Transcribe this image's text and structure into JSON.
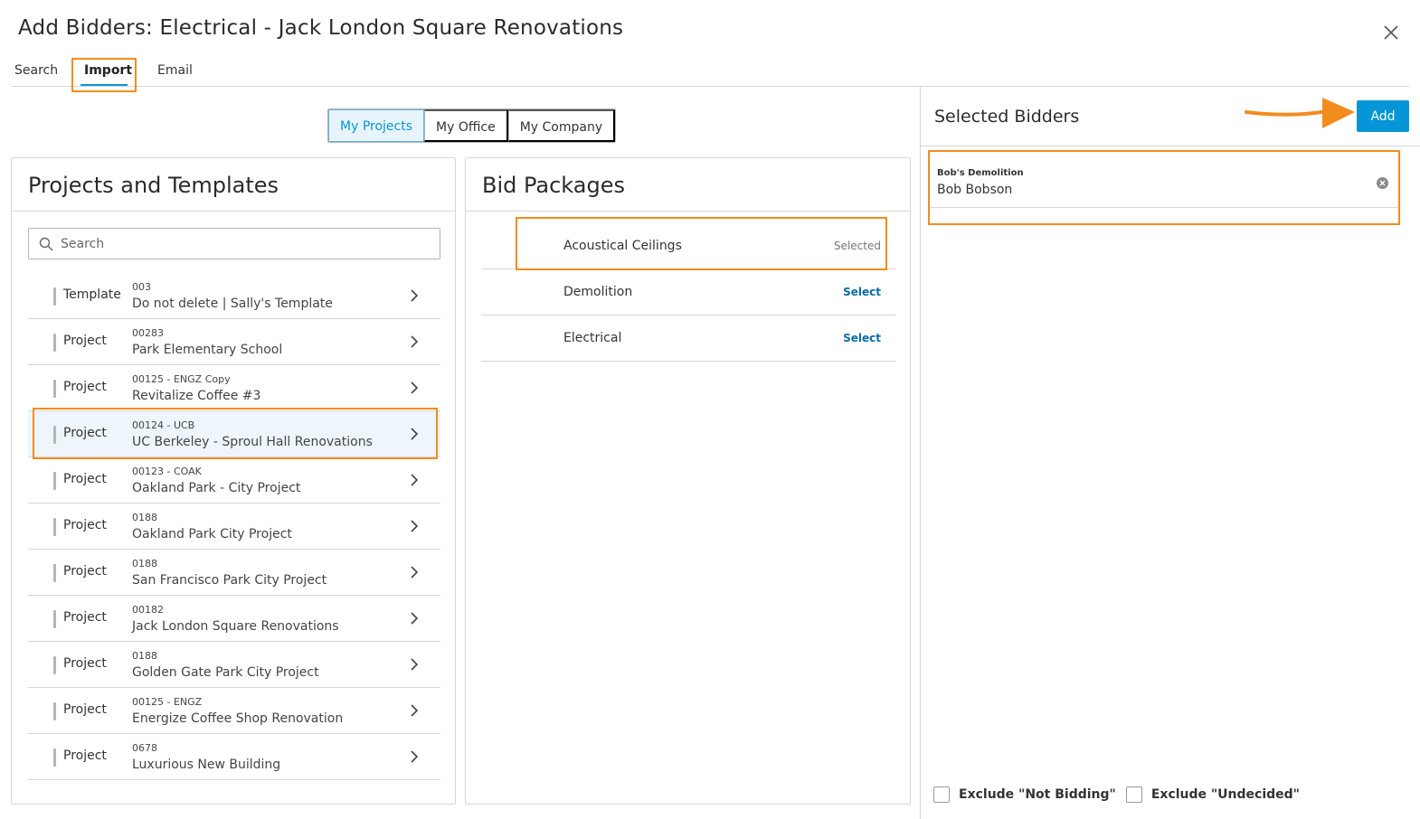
{
  "header": {
    "title": "Add Bidders: Electrical - Jack London Square Renovations"
  },
  "tabs": [
    {
      "label": "Search"
    },
    {
      "label": "Import"
    },
    {
      "label": "Email"
    }
  ],
  "scope": {
    "buttons": [
      {
        "label": "My Projects"
      },
      {
        "label": "My Office"
      },
      {
        "label": "My Company"
      }
    ],
    "active": "My Projects"
  },
  "projects_panel": {
    "title": "Projects and Templates",
    "search_placeholder": "Search",
    "items": [
      {
        "type": "Template",
        "number": "003",
        "name": "Do not delete | Sally's Template"
      },
      {
        "type": "Project",
        "number": "00283",
        "name": "Park Elementary School"
      },
      {
        "type": "Project",
        "number": "00125 - ENGZ Copy",
        "name": "Revitalize Coffee #3"
      },
      {
        "type": "Project",
        "number": "00124 - UCB",
        "name": "UC Berkeley - Sproul Hall Renovations"
      },
      {
        "type": "Project",
        "number": "00123 - COAK",
        "name": "Oakland Park - City Project"
      },
      {
        "type": "Project",
        "number": "0188",
        "name": "Oakland Park City Project"
      },
      {
        "type": "Project",
        "number": "0188",
        "name": "San Francisco Park City Project"
      },
      {
        "type": "Project",
        "number": "00182",
        "name": "Jack London Square Renovations"
      },
      {
        "type": "Project",
        "number": "0188",
        "name": "Golden Gate Park City Project"
      },
      {
        "type": "Project",
        "number": "00125 - ENGZ",
        "name": "Energize Coffee Shop Renovation"
      },
      {
        "type": "Project",
        "number": "0678",
        "name": "Luxurious New Building"
      }
    ]
  },
  "bid_packages": {
    "title": "Bid Packages",
    "items": [
      {
        "name": "Acoustical Ceilings",
        "status": "Selected"
      },
      {
        "name": "Demolition",
        "action": "Select"
      },
      {
        "name": "Electrical",
        "action": "Select"
      }
    ]
  },
  "selected_bidders": {
    "title": "Selected Bidders",
    "add_label": "Add",
    "items": [
      {
        "company": "Bob's Demolition",
        "contact": "Bob Bobson"
      }
    ]
  },
  "footer": {
    "exclude_not_bidding": "Exclude \"Not Bidding\"",
    "exclude_undecided": "Exclude \"Undecided\""
  },
  "colors": {
    "accent": "#0696d7",
    "highlight": "#f28c1e"
  }
}
